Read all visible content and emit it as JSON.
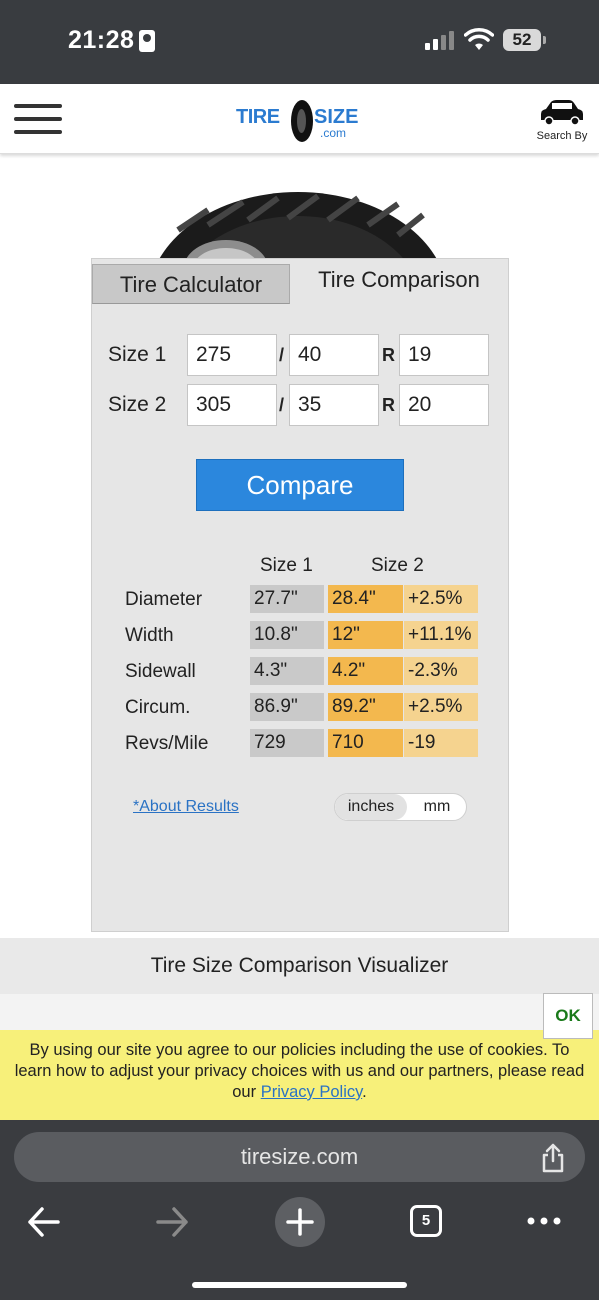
{
  "status_bar": {
    "time": "21:28",
    "battery": "52"
  },
  "header": {
    "logo": {
      "tire": "TIRE",
      "size": "SIZE",
      "com": ".com"
    },
    "search_by": "Search By"
  },
  "tabs": [
    {
      "label": "Tire Calculator",
      "active": false
    },
    {
      "label": "Tire Comparison",
      "active": true
    }
  ],
  "inputs": {
    "size1": {
      "label": "Size 1",
      "width": "275",
      "ratio": "40",
      "rim": "19"
    },
    "size2": {
      "label": "Size 2",
      "width": "305",
      "ratio": "35",
      "rim": "20"
    },
    "sep_slash": "/",
    "sep_r": "R"
  },
  "compare_label": "Compare",
  "results": {
    "headers": [
      "Size 1",
      "Size 2"
    ],
    "rows": [
      {
        "label": "Diameter",
        "size1": "27.7\"",
        "size2": "28.4\"",
        "diff": "+2.5%"
      },
      {
        "label": "Width",
        "size1": "10.8\"",
        "size2": "12\"",
        "diff": "+11.1%"
      },
      {
        "label": "Sidewall",
        "size1": "4.3\"",
        "size2": "4.2\"",
        "diff": "-2.3%"
      },
      {
        "label": "Circum.",
        "size1": "86.9\"",
        "size2": "89.2\"",
        "diff": "+2.5%"
      },
      {
        "label": "Revs/Mile",
        "size1": "729",
        "size2": "710",
        "diff": "-19"
      }
    ]
  },
  "about_results": "*About Results",
  "units": {
    "options": [
      "inches",
      "mm"
    ],
    "selected": "inches"
  },
  "visualizer_title": "Tire Size Comparison Visualizer",
  "cookie": {
    "text": "By using our site you agree to our policies including the use of cookies. To learn how to adjust your privacy choices with us and our partners, please read our ",
    "link": "Privacy Policy",
    "end": ".",
    "ok": "OK"
  },
  "browser": {
    "url": "tiresize.com",
    "tab_count": "5"
  },
  "colors": {
    "accent": "#2b87dd",
    "size2_cell": "#f3b84e",
    "diff_cell": "#f5d38f",
    "cookie_bg": "#f7f07a"
  },
  "icons": [
    "hamburger-icon",
    "car-icon",
    "share-icon",
    "back-icon",
    "forward-icon",
    "plus-icon",
    "tabs-icon",
    "more-icon",
    "wifi-icon",
    "signal-icon",
    "battery-icon"
  ]
}
